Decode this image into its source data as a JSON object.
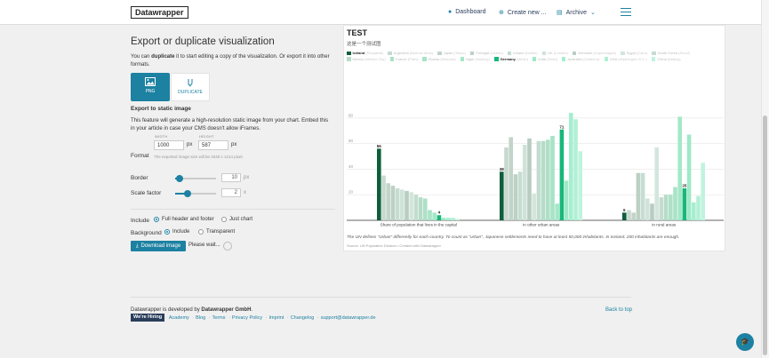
{
  "header": {
    "logo": "Datawrapper",
    "nav": [
      {
        "label": "Dashboard",
        "icon": "speedometer-icon"
      },
      {
        "label": "Create new ...",
        "icon": "plus-circle-icon"
      },
      {
        "label": "Archive",
        "icon": "folder-icon"
      }
    ],
    "menu_icon": "hamburger-menu-icon"
  },
  "panel": {
    "title": "Export or duplicate visualization",
    "intro_pre": "You can ",
    "intro_bold": "duplicate",
    "intro_post": " it to start editing a copy of the visualization. Or export it into other formats.",
    "tiles": [
      {
        "label": "PNG",
        "icon": "image-icon",
        "active": true
      },
      {
        "label": "DUPLICATE",
        "icon": "fork-icon",
        "active": false
      }
    ],
    "section_title": "Export to static image",
    "section_text": "This feature will generate a high-resolution static image from your chart. Embed this in your article in case your CMS doesn't allow iFrames.",
    "width_label": "WIDTH",
    "width_value": "1000",
    "height_label": "HEIGHT",
    "height_value": "587",
    "unit_px": "px",
    "format_label": "Format",
    "format_hint": "The exported image size will be 2040 x 1214 pixel.",
    "border_label": "Border",
    "border_value": "10",
    "border_unit": "px",
    "border_level": 0.1,
    "scale_label": "Scale factor",
    "scale_value": "2",
    "scale_unit": "x",
    "scale_level": 0.3,
    "include_label": "Include",
    "include_options": [
      "Full header and footer",
      "Just chart"
    ],
    "include_selected": 0,
    "background_label": "Background",
    "background_options": [
      "Include",
      "Transparent"
    ],
    "background_selected": 0,
    "download_label": "Download image",
    "download_icon": "download-icon",
    "status_text": "Please wait..."
  },
  "chart": {
    "title": "TEST",
    "subtitle": "这是一个测试图",
    "legend": [
      {
        "name": "Iceland",
        "city": "(Reykjavik)",
        "color": "#0d5e3a",
        "highlight": true
      },
      {
        "name": "Argentina",
        "city": "(Buenos Aires)",
        "color": "#c8d9cf",
        "highlight": false
      },
      {
        "name": "Japan",
        "city": "(Tokyo)",
        "color": "#c2d4c9",
        "highlight": false
      },
      {
        "name": "Portugal",
        "city": "(Lisbon)",
        "color": "#bdd0c4",
        "highlight": false
      },
      {
        "name": "Ireland",
        "city": "(Dublin)",
        "color": "#c6ddd2",
        "highlight": false
      },
      {
        "name": "UK",
        "city": "(London)",
        "color": "#cfe3d8",
        "highlight": false
      },
      {
        "name": "Denmark",
        "city": "(Copenhagen)",
        "color": "#b9ccc1",
        "highlight": false
      },
      {
        "name": "Egypt",
        "city": "(Cairo)",
        "color": "#d3e6dc",
        "highlight": false
      },
      {
        "name": "South Korea",
        "city": "(Seoul)",
        "color": "#c4dcd0",
        "highlight": false
      },
      {
        "name": "Mexico",
        "city": "(Mexico City)",
        "color": "#b5dcc8",
        "highlight": false
      },
      {
        "name": "France",
        "city": "(Paris)",
        "color": "#aee0c7",
        "highlight": false
      },
      {
        "name": "Russia",
        "city": "(Moscow)",
        "color": "#a8e3c6",
        "highlight": false
      },
      {
        "name": "Niger",
        "city": "(Niamey)",
        "color": "#a3e8c8",
        "highlight": false
      },
      {
        "name": "Germany",
        "city": "(Berlin)",
        "color": "#18b77a",
        "highlight": true
      },
      {
        "name": "India",
        "city": "(Delhi)",
        "color": "#9ee9c6",
        "highlight": false
      },
      {
        "name": "Australia",
        "city": "(Canberra)",
        "color": "#a6eed0",
        "highlight": false
      },
      {
        "name": "USA",
        "city": "(Washington D.C.)",
        "color": "#b2f0d6",
        "highlight": false
      },
      {
        "name": "China",
        "city": "(Beijing)",
        "color": "#c0f3de",
        "highlight": false
      }
    ],
    "note": "The UN defines \"Urban\" differently for each country. To count as \"urban\", Japanese settlements need to have at least 50,000 inhabitants. In Iceland, 200 inhabitants are enough.",
    "source": "Source: UN Population Division • Created with Datawrapper"
  },
  "chart_data": {
    "type": "bar",
    "categories": [
      "Share of population that lives in the capital",
      "in other urban areas",
      "in rural areas"
    ],
    "yticks": [
      20,
      40,
      60,
      80
    ],
    "ylim": [
      0,
      100
    ],
    "grid": true,
    "legend_position": "top",
    "series": [
      {
        "name": "Iceland (Reykjavik)",
        "values": [
          56,
          38,
          6
        ]
      },
      {
        "name": "Argentina (Buenos Aires)",
        "values": [
          35,
          57,
          8
        ]
      },
      {
        "name": "Japan (Tokyo)",
        "values": [
          29,
          65,
          6
        ]
      },
      {
        "name": "Portugal (Lisbon)",
        "values": [
          27,
          36,
          37
        ]
      },
      {
        "name": "Ireland (Dublin)",
        "values": [
          25,
          38,
          37
        ]
      },
      {
        "name": "UK (London)",
        "values": [
          24,
          59,
          17
        ]
      },
      {
        "name": "Denmark (Copenhagen)",
        "values": [
          23,
          64,
          13
        ]
      },
      {
        "name": "Egypt (Cairo)",
        "values": [
          22,
          21,
          57
        ]
      },
      {
        "name": "South Korea (Seoul)",
        "values": [
          20,
          62,
          18
        ]
      },
      {
        "name": "Mexico (Mexico City)",
        "values": [
          18,
          62,
          20
        ]
      },
      {
        "name": "France (Paris)",
        "values": [
          17,
          63,
          20
        ]
      },
      {
        "name": "Russia (Moscow)",
        "values": [
          8,
          66,
          26
        ]
      },
      {
        "name": "Niger (Niamey)",
        "values": [
          6,
          13,
          81
        ]
      },
      {
        "name": "Germany (Berlin)",
        "values": [
          4,
          71,
          25
        ]
      },
      {
        "name": "India (Delhi)",
        "values": [
          2,
          31,
          67
        ]
      },
      {
        "name": "Australia (Canberra)",
        "values": [
          2,
          84,
          14
        ]
      },
      {
        "name": "USA (Washington D.C.)",
        "values": [
          2,
          79,
          19
        ]
      },
      {
        "name": "China (Beijing)",
        "values": [
          1,
          54,
          45
        ]
      }
    ],
    "data_labels": [
      {
        "series": "Iceland (Reykjavik)",
        "values": [
          "56",
          "38",
          "6"
        ]
      },
      {
        "series": "Germany (Berlin)",
        "values": [
          "4",
          "71",
          "25"
        ]
      }
    ]
  },
  "footer": {
    "about_pre": "Datawrapper is developed by ",
    "about_bold": "Datawrapper GmbH",
    "about_post": ".",
    "hiring": "We're Hiring",
    "links": [
      "Academy",
      "Blog",
      "Terms",
      "Privacy Policy",
      "Imprint",
      "Changelog",
      "support@datawrapper.de"
    ],
    "back_to_top": "Back to top",
    "help_icon": "graduation-cap-icon"
  }
}
